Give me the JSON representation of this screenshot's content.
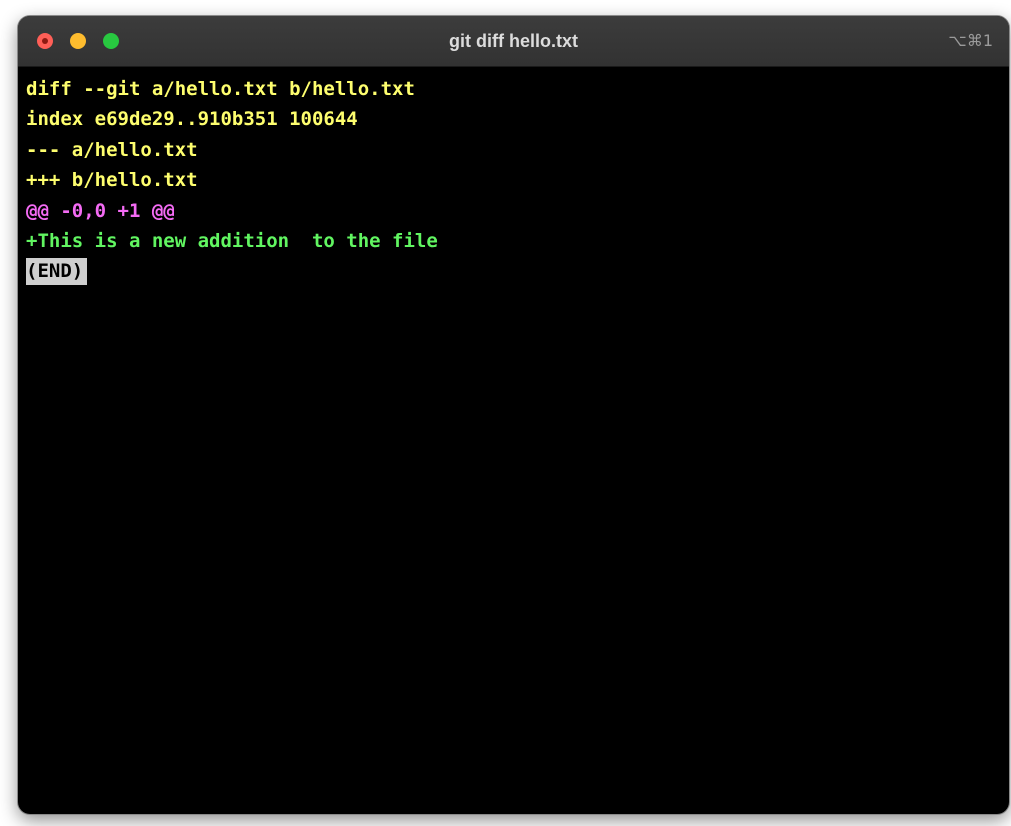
{
  "window": {
    "title": "git diff hello.txt",
    "shortcut": "⌥⌘1",
    "traffic_lights": [
      "close",
      "minimize",
      "zoom"
    ]
  },
  "terminal": {
    "lines": [
      {
        "text": "diff --git a/hello.txt b/hello.txt",
        "color": "#fefe6e"
      },
      {
        "text": "index e69de29..910b351 100644",
        "color": "#fefe6e"
      },
      {
        "text": "--- a/hello.txt",
        "color": "#fefe6e"
      },
      {
        "text": "+++ b/hello.txt",
        "color": "#fefe6e"
      },
      {
        "text": "@@ -0,0 +1 @@",
        "color": "#f46bf4"
      },
      {
        "text": "+This is a new addition  to the file",
        "color": "#61f561"
      }
    ],
    "pager_status": "(END)"
  }
}
